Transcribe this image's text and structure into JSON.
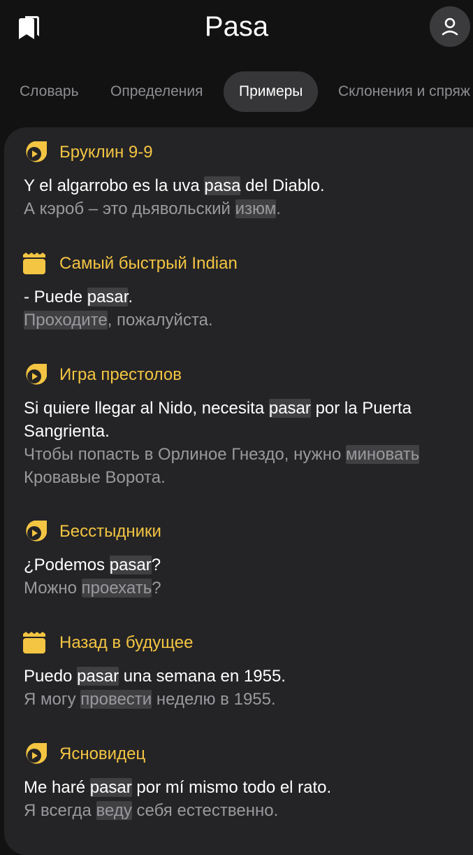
{
  "header": {
    "title": "Pasa",
    "bookmark_icon": "bookmark-icon",
    "profile_icon": "user-icon"
  },
  "tabs": [
    {
      "label": "Словарь",
      "active": false
    },
    {
      "label": "Определения",
      "active": false
    },
    {
      "label": "Примеры",
      "active": true
    },
    {
      "label": "Склонения и спряж",
      "active": false
    }
  ],
  "colors": {
    "background": "#121212",
    "card": "#242426",
    "accent": "#f4c542",
    "highlight": "#404043",
    "muted_text": "#9a9a9e"
  },
  "examples": [
    {
      "source": "Бруклин 9-9",
      "source_type": "series",
      "es": {
        "before": "Y el algarrobo es la uva ",
        "word": "pasa",
        "after": " del Diablo."
      },
      "ru": {
        "before": "А кэроб – это дьявольский ",
        "word": "изюм",
        "after": "."
      }
    },
    {
      "source": "Самый быстрый Indian",
      "source_type": "film",
      "es": {
        "before": "- Puede ",
        "word": "pasar",
        "after": "."
      },
      "ru": {
        "before": "",
        "word": "Проходите",
        "after": ", пожалуйста."
      }
    },
    {
      "source": "Игра престолов",
      "source_type": "series",
      "es": {
        "before": "Si quiere llegar al Nido, necesita ",
        "word": "pasar",
        "after": " por la Puerta Sangrienta."
      },
      "ru": {
        "before": "Чтобы попасть в Орлиное Гнездо, нужно ",
        "word": "миновать",
        "after": " Кровавые Ворота."
      }
    },
    {
      "source": "Бесстыдники",
      "source_type": "series",
      "es": {
        "before": "¿Podemos ",
        "word": "pasar",
        "after": "?"
      },
      "ru": {
        "before": "Можно ",
        "word": "проехать",
        "after": "?"
      }
    },
    {
      "source": "Назад в будущее",
      "source_type": "film",
      "es": {
        "before": "Puedo ",
        "word": "pasar",
        "after": " una semana en 1955."
      },
      "ru": {
        "before": "Я могу ",
        "word": "провести",
        "after": " неделю в 1955."
      }
    },
    {
      "source": "Ясновидец",
      "source_type": "series",
      "es": {
        "before": "Me haré ",
        "word": "pasar",
        "after": " por mí mismo todo el rato."
      },
      "ru": {
        "before": "Я всегда ",
        "word": "веду",
        "after": " себя естественно."
      }
    }
  ]
}
